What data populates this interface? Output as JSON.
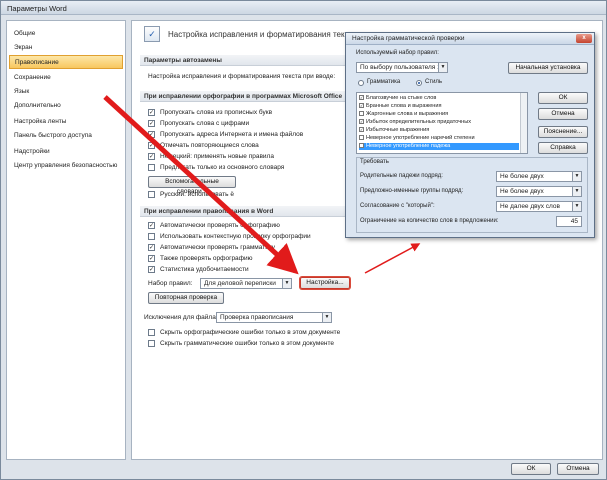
{
  "window": {
    "title": "Параметры Word"
  },
  "sidebar": {
    "items": [
      {
        "label": "Общие"
      },
      {
        "label": "Экран"
      },
      {
        "label": "Правописание",
        "active": true
      },
      {
        "label": "Сохранение"
      },
      {
        "label": "Язык"
      },
      {
        "label": "Дополнительно"
      },
      {
        "label": "Настройка ленты"
      },
      {
        "label": "Панель быстрого доступа"
      },
      {
        "label": "Надстройки"
      },
      {
        "label": "Центр управления безопасностью"
      }
    ]
  },
  "main": {
    "header_title": "Настройка исправления и форматирования текста.",
    "autocorrect": {
      "section": "Параметры автозамены",
      "text": "Настройка исправления и форматирования текста при вводе:"
    },
    "office_spelling": {
      "section": "При исправлении орфографии в программах Microsoft Office",
      "items": [
        {
          "label": "Пропускать слова из прописных букв",
          "checked": true
        },
        {
          "label": "Пропускать слова с цифрами",
          "checked": true
        },
        {
          "label": "Пропускать адреса Интернета и имена файлов",
          "checked": true
        },
        {
          "label": "Отмечать повторяющиеся слова",
          "checked": true
        },
        {
          "label": "Немецкий: применять новые правила",
          "checked": true
        },
        {
          "label": "Предлагать только из основного словаря",
          "checked": false
        }
      ],
      "dictionaries_button": "Вспомогательные словари...",
      "russian_label": "Русский: использовать ё"
    },
    "word_spelling": {
      "section": "При исправлении правописания в Word",
      "items": [
        {
          "label": "Автоматически проверять орфографию",
          "checked": true
        },
        {
          "label": "Использовать контекстную проверку орфографии",
          "checked": false
        },
        {
          "label": "Автоматически проверять грамматику",
          "checked": true
        },
        {
          "label": "Также проверять орфографию",
          "checked": true
        },
        {
          "label": "Статистика удобочитаемости",
          "checked": true
        }
      ],
      "ruleset_label": "Набор правил:",
      "ruleset_value": "Для деловой переписки",
      "settings_button": "Настройка...",
      "recheck_button": "Повторная проверка"
    },
    "exceptions": {
      "label": "Исключения для файла:",
      "file_value": "Проверка правописания",
      "items": [
        {
          "label": "Скрыть орфографические ошибки только в этом документе",
          "checked": false
        },
        {
          "label": "Скрыть грамматические ошибки только в этом документе",
          "checked": false
        }
      ]
    }
  },
  "footer": {
    "ok": "ОК",
    "cancel": "Отмена"
  },
  "dialog": {
    "title": "Настройка грамматической проверки",
    "close": "x",
    "ruleset_label": "Используемый набор правил:",
    "ruleset_value": "По выбору пользователя 1",
    "reset_button": "Начальная установка",
    "radio_grammar": "Грамматика",
    "radio_style": "Стиль",
    "list_items": [
      {
        "label": "Благозвучие на стыке слов",
        "checked": true
      },
      {
        "label": "Бранные слова и выражения",
        "checked": true
      },
      {
        "label": "Жаргонные слова и выражения",
        "checked": false
      },
      {
        "label": "Избыток определительных придаточных",
        "checked": true
      },
      {
        "label": "Избыточные выражения",
        "checked": true
      },
      {
        "label": "Неверное употребление наречий степени",
        "checked": false
      },
      {
        "label": "Неверное употребление падежа",
        "checked": false,
        "selected": true
      }
    ],
    "ok_button": "ОК",
    "cancel_button": "Отмена",
    "explain_button": "Пояснение...",
    "help_button": "Справка",
    "requires_label": "Требовать",
    "fields": [
      {
        "label": "Родительные падежи подряд:",
        "value": "Не более двух"
      },
      {
        "label": "Предложно-именные группы подряд:",
        "value": "Не более двух"
      },
      {
        "label": "Согласование с \"который\":",
        "value": "Не далее двух слов"
      }
    ],
    "limit_label": "Ограничение на количество слов в предложении:",
    "limit_value": "45"
  },
  "colors": {
    "accent_arrow": "#e11b1b",
    "selection": "#3399ff",
    "active_item": "#f8c75f"
  }
}
